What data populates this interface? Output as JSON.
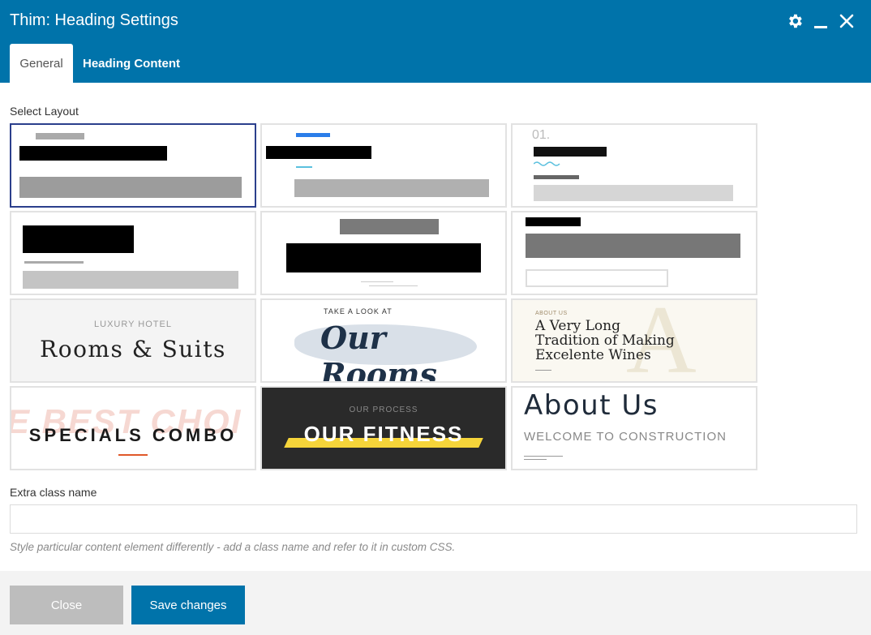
{
  "window": {
    "title": "Thim: Heading Settings",
    "controls": {
      "settings_icon": "gear-icon",
      "minimize_icon": "minimize-icon",
      "close_icon": "close-icon"
    }
  },
  "tabs": [
    {
      "label": "General",
      "active": true
    },
    {
      "label": "Heading Content",
      "active": false
    }
  ],
  "select_layout": {
    "label": "Select Layout",
    "selected_index": 0,
    "layouts": [
      {
        "id": 1
      },
      {
        "id": 2
      },
      {
        "id": 3,
        "number": "01."
      },
      {
        "id": 4
      },
      {
        "id": 5
      },
      {
        "id": 6
      },
      {
        "id": 7,
        "subtitle": "LUXURY HOTEL",
        "title": "Rooms & Suits"
      },
      {
        "id": 8,
        "subtitle": "TAKE A LOOK AT",
        "title": "Our Rooms"
      },
      {
        "id": 9,
        "subtitle": "ABOUT US",
        "title_lines": [
          "A Very Long",
          "Tradition of Making",
          "Excelente Wines"
        ],
        "bg_letter": "A"
      },
      {
        "id": 10,
        "bg_text": "E BEST CHOI",
        "title": "SPECIALS COMBO"
      },
      {
        "id": 11,
        "subtitle": "OUR PROCESS",
        "title": "OUR FITNESS"
      },
      {
        "id": 12,
        "title": "About Us",
        "subtitle": "WELCOME TO CONSTRUCTION"
      }
    ]
  },
  "extra_class": {
    "label": "Extra class name",
    "value": "",
    "placeholder": "",
    "hint": "Style particular content element differently - add a class name and refer to it in custom CSS."
  },
  "footer": {
    "close_label": "Close",
    "save_label": "Save changes"
  },
  "colors": {
    "brand": "#0073aa",
    "selected_border": "#2b3f8c",
    "close_button": "#bdbdbd",
    "accent_blue": "#2b7de9",
    "accent_orange": "#e0582a",
    "accent_yellow": "#f5d43a"
  }
}
